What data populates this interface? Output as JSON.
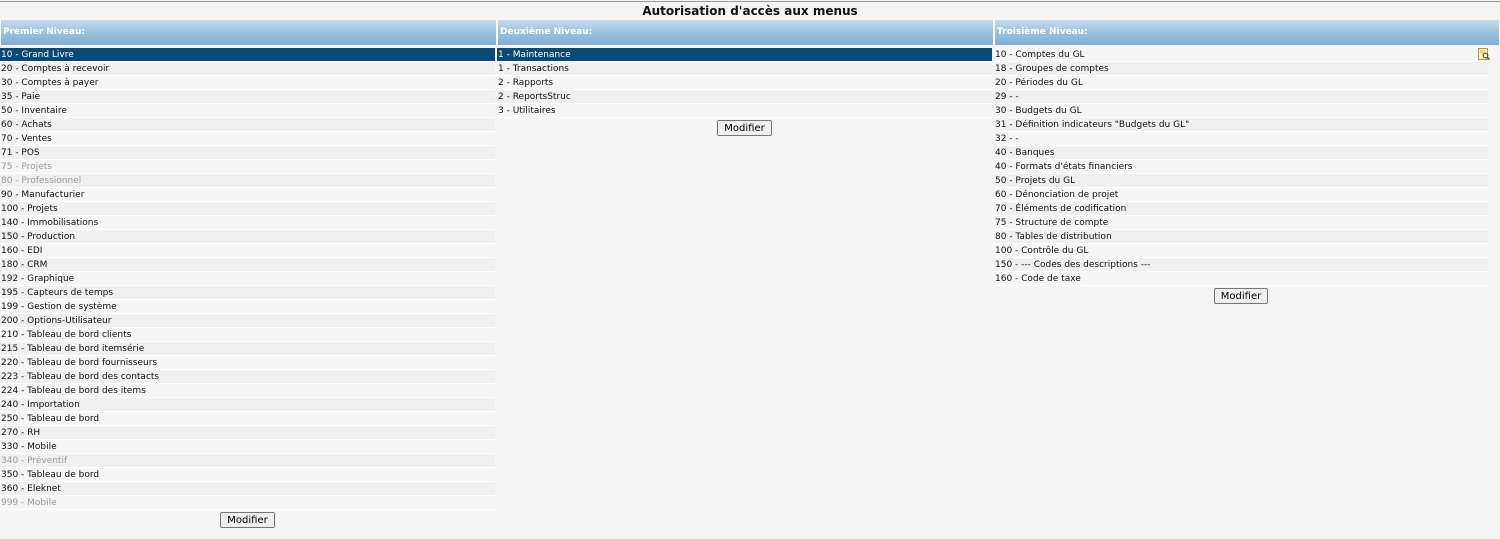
{
  "page": {
    "title": "Autorisation d'accès aux menus"
  },
  "columns": [
    {
      "header": "Premier Niveau:",
      "button": "Modifier",
      "items": [
        {
          "label": "10 - Grand Livre",
          "selected": true
        },
        {
          "label": "20 - Comptes à recevoir"
        },
        {
          "label": "30 - Comptes à payer"
        },
        {
          "label": "35 - Paie"
        },
        {
          "label": "50 - Inventaire"
        },
        {
          "label": "60 - Achats"
        },
        {
          "label": "70 - Ventes"
        },
        {
          "label": "71 - POS"
        },
        {
          "label": "75 - Projets",
          "disabled": true
        },
        {
          "label": "80 - Professionnel",
          "disabled": true
        },
        {
          "label": "90 - Manufacturier"
        },
        {
          "label": "100 - Projets"
        },
        {
          "label": "140 - Immobilisations"
        },
        {
          "label": "150 - Production"
        },
        {
          "label": "160 - EDI"
        },
        {
          "label": "180 - CRM"
        },
        {
          "label": "192 - Graphique"
        },
        {
          "label": "195 - Capteurs de temps"
        },
        {
          "label": "199 - Gestion de système"
        },
        {
          "label": "200 - Options-Utilisateur"
        },
        {
          "label": "210 - Tableau de bord clients"
        },
        {
          "label": "215 - Tableau de bord itemsérie"
        },
        {
          "label": "220 - Tableau de bord fournisseurs"
        },
        {
          "label": "223 - Tableau de bord des contacts"
        },
        {
          "label": "224 - Tableau de bord des items"
        },
        {
          "label": "240 - Importation"
        },
        {
          "label": "250 - Tableau de bord"
        },
        {
          "label": "270 - RH"
        },
        {
          "label": "330 - Mobile"
        },
        {
          "label": "340 - Préventif",
          "disabled": true
        },
        {
          "label": "350 - Tableau de bord"
        },
        {
          "label": "360 - Eleknet"
        },
        {
          "label": "999 - Mobile",
          "disabled": true
        }
      ]
    },
    {
      "header": "Deuxième Niveau:",
      "button": "Modifier",
      "items": [
        {
          "label": "1 - Maintenance",
          "selected": true
        },
        {
          "label": "1 - Transactions"
        },
        {
          "label": "2 - Rapports"
        },
        {
          "label": "2 - ReportsStruc"
        },
        {
          "label": "3 - Utilitaires"
        }
      ]
    },
    {
      "header": "Troisième Niveau:",
      "button": "Modifier",
      "icon": "zoom-icon",
      "items": [
        {
          "label": "10 - Comptes du GL"
        },
        {
          "label": "18 - Groupes de comptes"
        },
        {
          "label": "20 - Périodes du GL"
        },
        {
          "label": "29 - -"
        },
        {
          "label": "30 - Budgets du GL"
        },
        {
          "label": "31 - Définition indicateurs \"Budgets du GL\""
        },
        {
          "label": "32 - -"
        },
        {
          "label": "40 - Banques"
        },
        {
          "label": "40 - Formats d'états financiers"
        },
        {
          "label": "50 - Projets du GL"
        },
        {
          "label": "60 - Dénonciation de projet"
        },
        {
          "label": "70 - Éléments de codification"
        },
        {
          "label": "75 - Structure de compte"
        },
        {
          "label": "80 - Tables de distribution"
        },
        {
          "label": "100 - Contrôle du GL"
        },
        {
          "label": "150 - --- Codes des descriptions ---"
        },
        {
          "label": "160 - Code de taxe"
        }
      ]
    }
  ]
}
